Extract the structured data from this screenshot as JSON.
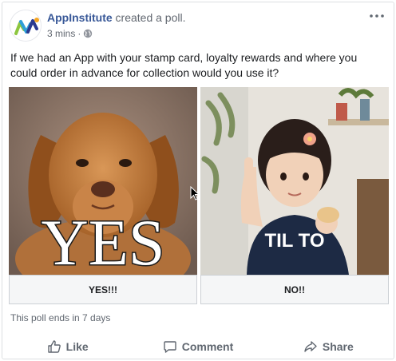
{
  "post": {
    "author": "AppInstitute",
    "action": "created a poll.",
    "time": "3 mins",
    "separator": "·",
    "privacy_icon": "globe-icon",
    "text": "If we had an App with your stamp card, loyalty rewards and where you could order in advance for collection would you use it?"
  },
  "poll": {
    "options": [
      {
        "label": "YES!!!",
        "image_text": "YES"
      },
      {
        "label": "NO!!",
        "image_text": "TIL TO"
      }
    ],
    "ends_text": "This poll ends in 7 days"
  },
  "actions": {
    "like": "Like",
    "comment": "Comment",
    "share": "Share"
  },
  "colors": {
    "link": "#385898",
    "muted": "#606770",
    "border": "#dddfe2",
    "option_bg": "#f5f6f7"
  }
}
